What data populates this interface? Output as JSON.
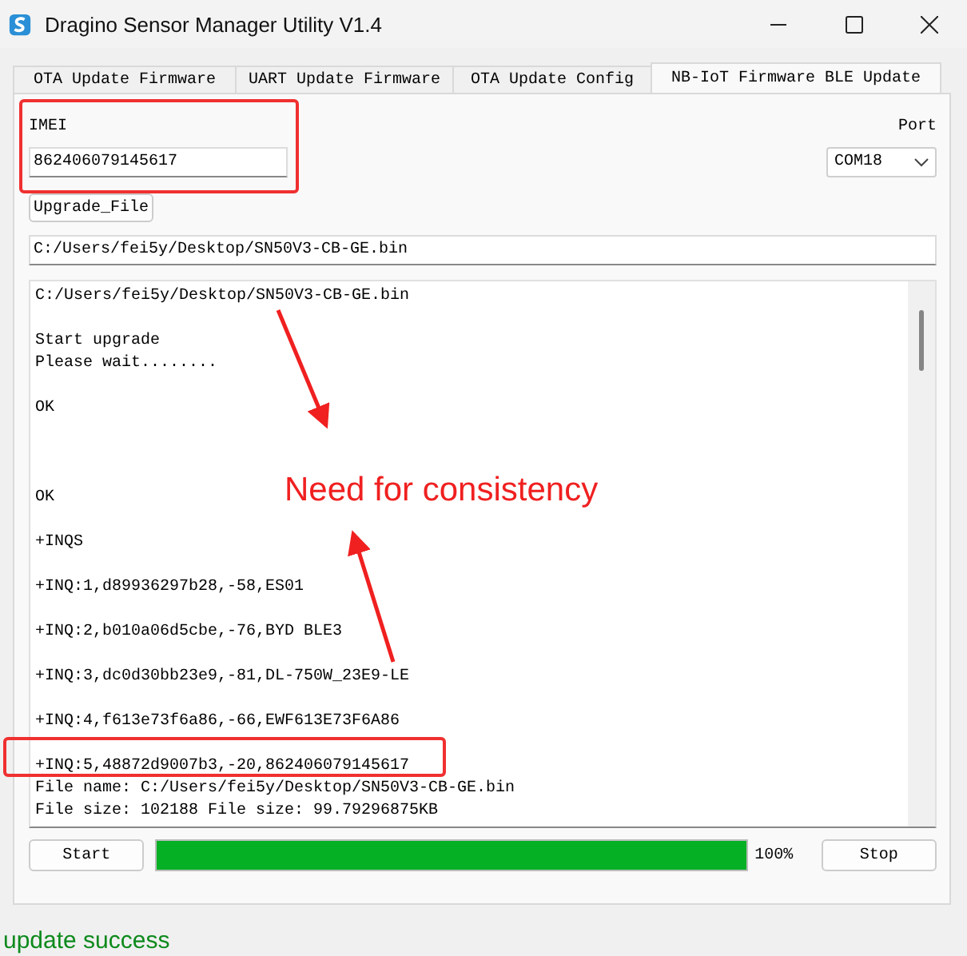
{
  "window": {
    "title": "Dragino Sensor Manager Utility V1.4"
  },
  "tabs": [
    {
      "label": "OTA Update Firmware",
      "selected": false
    },
    {
      "label": "UART Update Firmware",
      "selected": false
    },
    {
      "label": "OTA Update Config",
      "selected": false
    },
    {
      "label": "NB-IoT Firmware BLE Update",
      "selected": true
    }
  ],
  "imei": {
    "label": "IMEI",
    "value": "862406079145617"
  },
  "port": {
    "label": "Port",
    "value": "COM18"
  },
  "upgrade_file_button": "Upgrade_File",
  "file_path": {
    "value": "C:/Users/fei5y/Desktop/SN50V3-CB-GE.bin"
  },
  "log": [
    {
      "kind": "line",
      "text": "C:/Users/fei5y/Desktop/SN50V3-CB-GE.bin"
    },
    {
      "kind": "blank"
    },
    {
      "kind": "line",
      "text": "Start upgrade"
    },
    {
      "kind": "line",
      "text": "Please wait........"
    },
    {
      "kind": "blank"
    },
    {
      "kind": "line",
      "text": "OK"
    },
    {
      "kind": "blank"
    },
    {
      "kind": "blank"
    },
    {
      "kind": "blank"
    },
    {
      "kind": "line",
      "text": "OK"
    },
    {
      "kind": "blank"
    },
    {
      "kind": "line",
      "text": "+INQS"
    },
    {
      "kind": "blank"
    },
    {
      "kind": "line",
      "text": "+INQ:1,d89936297b28,-58,ES01"
    },
    {
      "kind": "blank"
    },
    {
      "kind": "line",
      "text": "+INQ:2,b010a06d5cbe,-76,BYD BLE3"
    },
    {
      "kind": "blank"
    },
    {
      "kind": "line",
      "text": "+INQ:3,dc0d30bb23e9,-81,DL-750W_23E9-LE"
    },
    {
      "kind": "blank"
    },
    {
      "kind": "line",
      "text": "+INQ:4,f613e73f6a86,-66,EWF613E73F6A86"
    },
    {
      "kind": "blank"
    },
    {
      "kind": "line",
      "text": "+INQ:5,48872d9007b3,-20,862406079145617"
    },
    {
      "kind": "line",
      "text": "File name: C:/Users/fei5y/Desktop/SN50V3-CB-GE.bin"
    },
    {
      "kind": "line",
      "text": "File size: 102188 File size: 99.79296875KB"
    }
  ],
  "start_button": "Start",
  "progress": {
    "level": 1.0,
    "reading": "100%"
  },
  "stop_button": "Stop",
  "status": "update success",
  "annotation": {
    "text": "Need for consistency"
  }
}
